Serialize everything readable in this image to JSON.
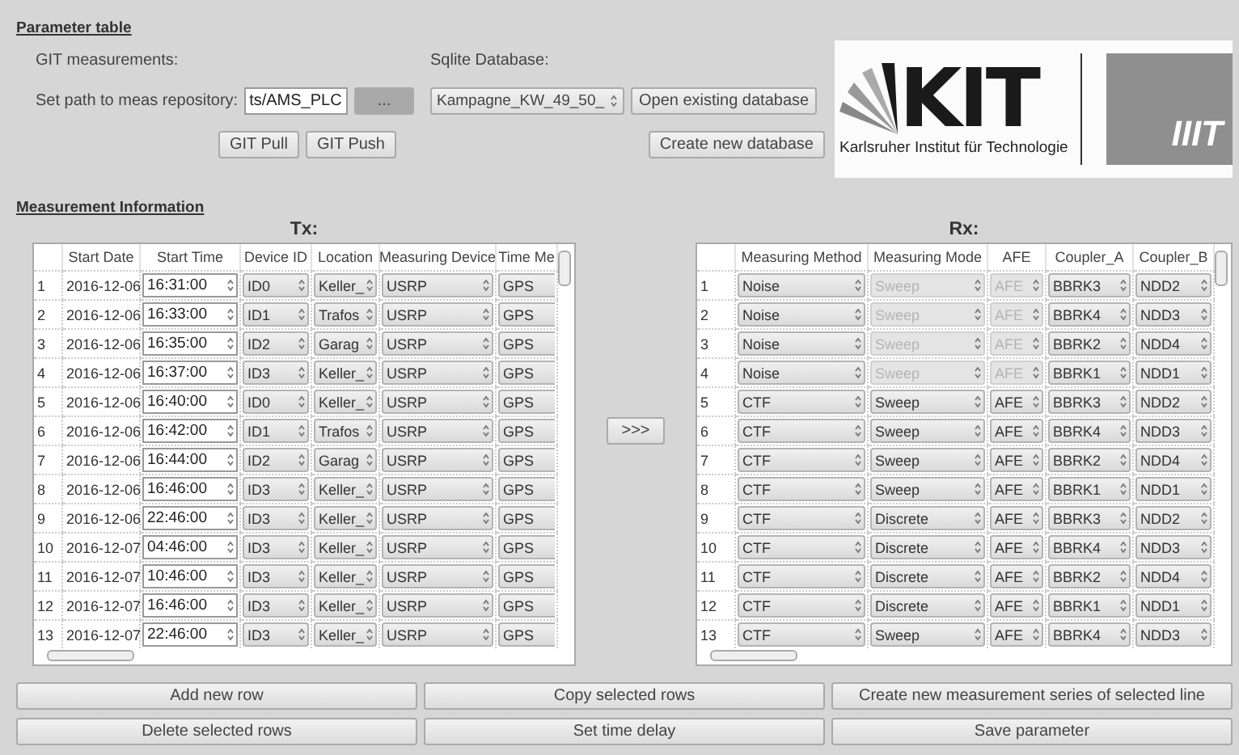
{
  "section_title": "Parameter table",
  "git": {
    "label": "GIT measurements:",
    "path_label": "Set path to meas repository:",
    "path_value": "ts/AMS_PLC",
    "browse_button": "...",
    "pull_button": "GIT Pull",
    "push_button": "GIT Push"
  },
  "database": {
    "label": "Sqlite Database:",
    "selected": "Kampagne_KW_49_50_",
    "open_button": "Open existing database",
    "create_button": "Create new database"
  },
  "logo": {
    "name": "KIT",
    "subtitle": "Karlsruher Institut für Technologie",
    "institute": "IIIT"
  },
  "measurement_title": "Measurement Information",
  "tx": {
    "title": "Tx:",
    "columns": [
      {
        "label": "Start Date",
        "kind": "text"
      },
      {
        "label": "Start Time",
        "kind": "time"
      },
      {
        "label": "Device ID",
        "kind": "combo"
      },
      {
        "label": "Location",
        "kind": "combo"
      },
      {
        "label": "Measuring Device",
        "kind": "combo"
      },
      {
        "label": "Time Me",
        "kind": "partial"
      }
    ],
    "rows": [
      {
        "index": "1",
        "cells": [
          "2016-12-06",
          "16:31:00",
          "ID0",
          "Keller_",
          "USRP",
          "GPS"
        ]
      },
      {
        "index": "2",
        "cells": [
          "2016-12-06",
          "16:33:00",
          "ID1",
          "Trafos",
          "USRP",
          "GPS"
        ]
      },
      {
        "index": "3",
        "cells": [
          "2016-12-06",
          "16:35:00",
          "ID2",
          "Garag",
          "USRP",
          "GPS"
        ]
      },
      {
        "index": "4",
        "cells": [
          "2016-12-06",
          "16:37:00",
          "ID3",
          "Keller_",
          "USRP",
          "GPS"
        ]
      },
      {
        "index": "5",
        "cells": [
          "2016-12-06",
          "16:40:00",
          "ID0",
          "Keller_",
          "USRP",
          "GPS"
        ]
      },
      {
        "index": "6",
        "cells": [
          "2016-12-06",
          "16:42:00",
          "ID1",
          "Trafos",
          "USRP",
          "GPS"
        ]
      },
      {
        "index": "7",
        "cells": [
          "2016-12-06",
          "16:44:00",
          "ID2",
          "Garag",
          "USRP",
          "GPS"
        ]
      },
      {
        "index": "8",
        "cells": [
          "2016-12-06",
          "16:46:00",
          "ID3",
          "Keller_",
          "USRP",
          "GPS"
        ]
      },
      {
        "index": "9",
        "cells": [
          "2016-12-06",
          "22:46:00",
          "ID3",
          "Keller_",
          "USRP",
          "GPS"
        ]
      },
      {
        "index": "10",
        "cells": [
          "2016-12-07",
          "04:46:00",
          "ID3",
          "Keller_",
          "USRP",
          "GPS"
        ]
      },
      {
        "index": "11",
        "cells": [
          "2016-12-07",
          "10:46:00",
          "ID3",
          "Keller_",
          "USRP",
          "GPS"
        ]
      },
      {
        "index": "12",
        "cells": [
          "2016-12-07",
          "16:46:00",
          "ID3",
          "Keller_",
          "USRP",
          "GPS"
        ]
      },
      {
        "index": "13",
        "cells": [
          "2016-12-07",
          "22:46:00",
          "ID3",
          "Keller_",
          "USRP",
          "GPS"
        ]
      }
    ]
  },
  "transfer_button": ">>>",
  "rx": {
    "title": "Rx:",
    "columns": [
      {
        "label": "Measuring Method",
        "kind": "combo"
      },
      {
        "label": "Measuring Mode",
        "kind": "dependent"
      },
      {
        "label": "AFE",
        "kind": "dependent"
      },
      {
        "label": "Coupler_A",
        "kind": "combo"
      },
      {
        "label": "Coupler_B",
        "kind": "combo"
      }
    ],
    "rows": [
      {
        "index": "1",
        "disabled": true,
        "cells": [
          "Noise",
          "Sweep",
          "AFE",
          "BBRK3",
          "NDD2"
        ]
      },
      {
        "index": "2",
        "disabled": true,
        "cells": [
          "Noise",
          "Sweep",
          "AFE",
          "BBRK4",
          "NDD3"
        ]
      },
      {
        "index": "3",
        "disabled": true,
        "cells": [
          "Noise",
          "Sweep",
          "AFE",
          "BBRK2",
          "NDD4"
        ]
      },
      {
        "index": "4",
        "disabled": true,
        "cells": [
          "Noise",
          "Sweep",
          "AFE",
          "BBRK1",
          "NDD1"
        ]
      },
      {
        "index": "5",
        "disabled": false,
        "cells": [
          "CTF",
          "Sweep",
          "AFE",
          "BBRK3",
          "NDD2"
        ]
      },
      {
        "index": "6",
        "disabled": false,
        "cells": [
          "CTF",
          "Sweep",
          "AFE",
          "BBRK4",
          "NDD3"
        ]
      },
      {
        "index": "7",
        "disabled": false,
        "cells": [
          "CTF",
          "Sweep",
          "AFE",
          "BBRK2",
          "NDD4"
        ]
      },
      {
        "index": "8",
        "disabled": false,
        "cells": [
          "CTF",
          "Sweep",
          "AFE",
          "BBRK1",
          "NDD1"
        ]
      },
      {
        "index": "9",
        "disabled": false,
        "cells": [
          "CTF",
          "Discrete",
          "AFE",
          "BBRK3",
          "NDD2"
        ]
      },
      {
        "index": "10",
        "disabled": false,
        "cells": [
          "CTF",
          "Discrete",
          "AFE",
          "BBRK4",
          "NDD3"
        ]
      },
      {
        "index": "11",
        "disabled": false,
        "cells": [
          "CTF",
          "Discrete",
          "AFE",
          "BBRK2",
          "NDD4"
        ]
      },
      {
        "index": "12",
        "disabled": false,
        "cells": [
          "CTF",
          "Discrete",
          "AFE",
          "BBRK1",
          "NDD1"
        ]
      },
      {
        "index": "13",
        "disabled": false,
        "cells": [
          "CTF",
          "Sweep",
          "AFE",
          "BBRK4",
          "NDD3"
        ]
      }
    ]
  },
  "buttons": [
    "Add new row",
    "Copy selected rows",
    "Create new measurement series of selected line",
    "Delete selected rows",
    "Set time delay",
    "Save parameter"
  ]
}
